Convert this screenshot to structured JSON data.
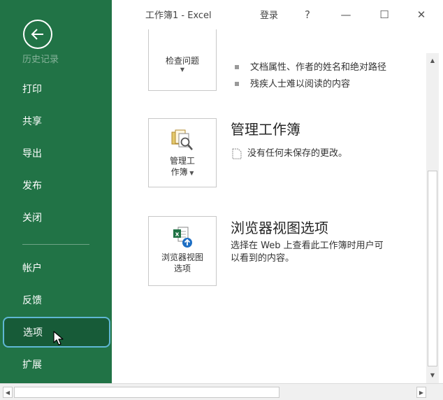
{
  "window": {
    "title": "工作簿1  -  Excel",
    "login": "登录",
    "help": "?",
    "minimize": "—",
    "maximize": "☐",
    "close": "✕"
  },
  "sidebar": {
    "back_icon": "back-arrow-icon",
    "history": "历史记录",
    "items": [
      "打印",
      "共享",
      "导出",
      "发布",
      "关闭",
      "帐户",
      "反馈",
      "选项",
      "扩展"
    ],
    "selected": "选项",
    "accent": "#217346",
    "selected_border": "#5fb7d4"
  },
  "sections": {
    "inspect": {
      "button_label": "检查问题",
      "bullets": [
        "文档属性、作者的姓名和绝对路径",
        "残疾人士难以阅读的内容"
      ]
    },
    "manage": {
      "title": "管理工作簿",
      "button_line1": "管理工",
      "button_line2": "作簿",
      "status": "没有任何未保存的更改。"
    },
    "browser": {
      "title": "浏览器视图选项",
      "button_line1": "浏览器视图",
      "button_line2": "选项",
      "desc_line1": "选择在 Web 上查看此工作簿时用户可",
      "desc_line2": "以看到的内容。"
    }
  }
}
